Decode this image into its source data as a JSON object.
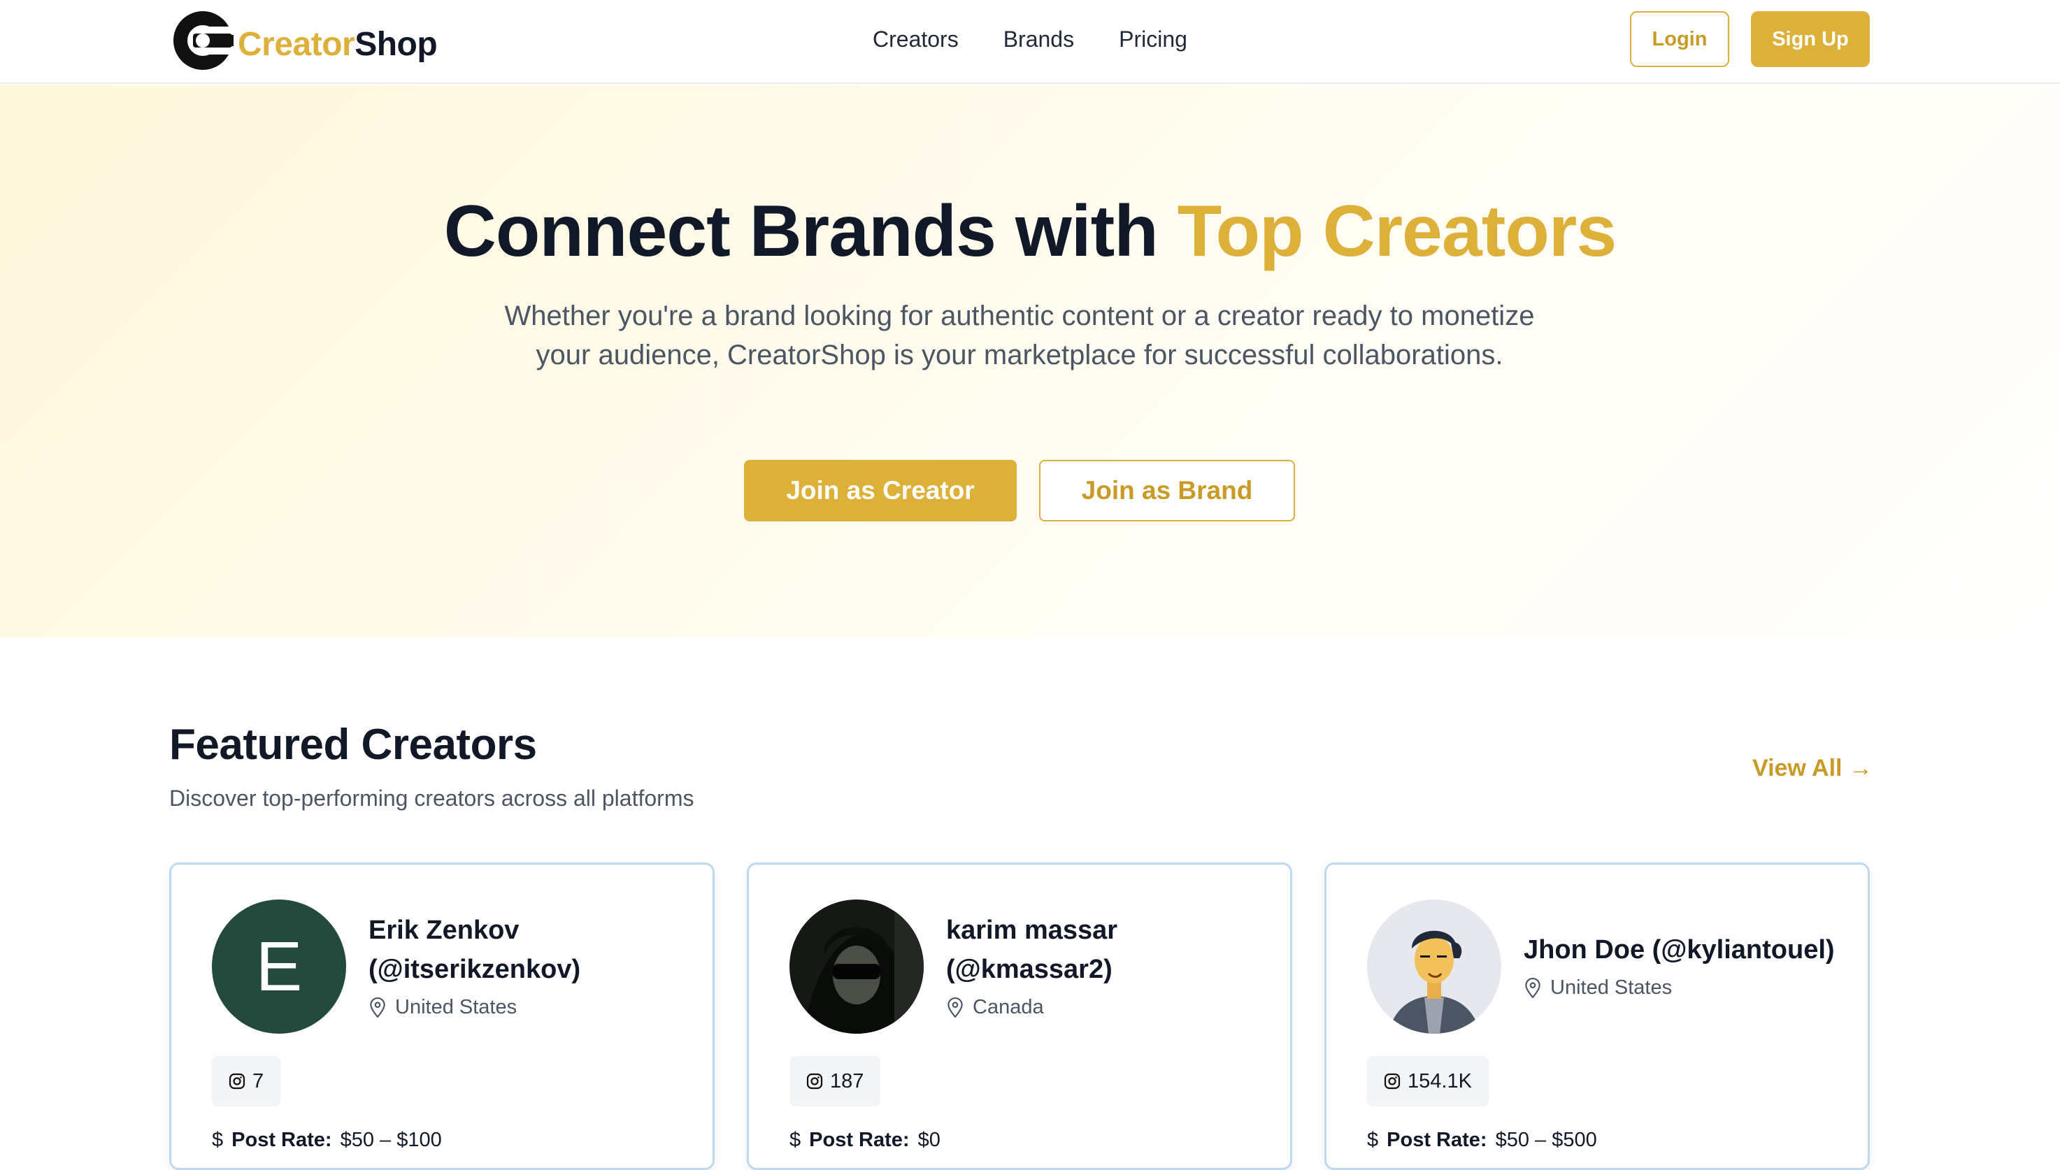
{
  "brand": {
    "name_part1": "Creator",
    "name_part2": "Shop",
    "logo_icon": "c-logo-icon",
    "accent": "#DDB03A"
  },
  "nav": {
    "links": [
      "Creators",
      "Brands",
      "Pricing"
    ],
    "login": "Login",
    "signup": "Sign Up"
  },
  "hero": {
    "title_plain": "Connect Brands with ",
    "title_accent": "Top Creators",
    "subtitle": "Whether you're a brand looking for authentic content or a creator ready to monetize your audience, CreatorShop is your marketplace for successful collaborations.",
    "cta_creator": "Join as Creator",
    "cta_brand": "Join as Brand"
  },
  "featured": {
    "title": "Featured Creators",
    "subtitle": "Discover top-performing creators across all platforms",
    "view_all": "View All →",
    "creators": [
      {
        "name_line1": "Erik Zenkov",
        "name_line2": "(@itserikzenkov)",
        "location": "United States",
        "avatar_letter": "E",
        "followers": "7",
        "rate_label": "Post Rate:",
        "rate": "$50 – $100"
      },
      {
        "name_line1": "karim massar",
        "name_line2": "(@kmassar2)",
        "location": "Canada",
        "followers": "187",
        "rate_label": "Post Rate:",
        "rate": "$0"
      },
      {
        "name_line1": "Jhon Doe (@kyliantouel)",
        "location": "United States",
        "followers": "154.1K",
        "rate_label": "Post Rate:",
        "rate": "$50 – $500"
      }
    ]
  }
}
